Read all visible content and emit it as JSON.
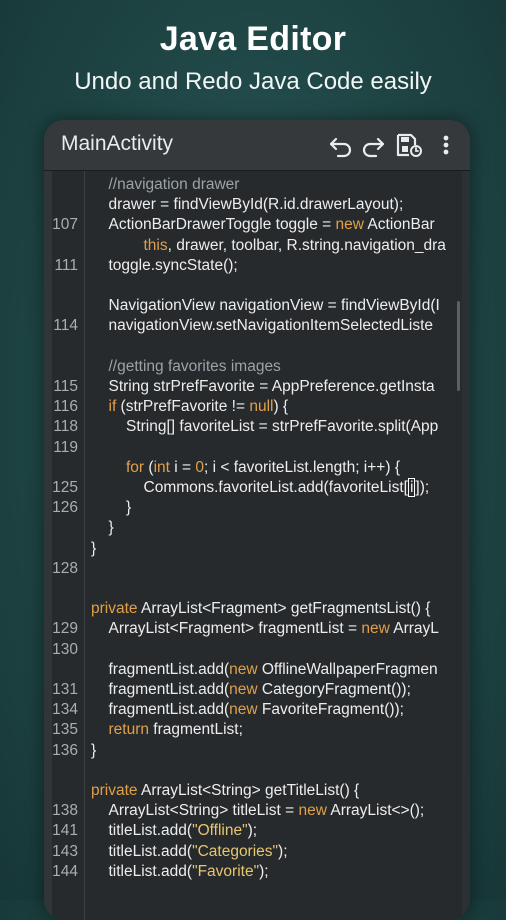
{
  "promo": {
    "title": "Java Editor",
    "subtitle": "Undo and Redo Java Code easily"
  },
  "toolbar": {
    "title": "MainActivity",
    "icons": [
      "undo-icon",
      "redo-icon",
      "save-icon",
      "more-vert-icon"
    ]
  },
  "colors": {
    "background": "#1f4545",
    "editor_bg": "#272a2d",
    "toolbar_bg": "#35393c",
    "keyword": "#e0a04a",
    "string": "#e7c66c",
    "comment": "#9aa3a8",
    "text": "#ededed",
    "line_number": "#a8aeb1"
  },
  "editor": {
    "lines": [
      {
        "no": "",
        "indent": 1,
        "segs": [
          [
            "c",
            "//navigation drawer"
          ]
        ]
      },
      {
        "no": "",
        "indent": 1,
        "segs": [
          [
            "t",
            "drawer = findViewById(R.id.drawerLayout);"
          ]
        ]
      },
      {
        "no": "107",
        "indent": 1,
        "segs": [
          [
            "t",
            "ActionBarDrawerToggle toggle = "
          ],
          [
            "k",
            "new"
          ],
          [
            "t",
            " ActionBar"
          ]
        ]
      },
      {
        "no": "",
        "indent": 3,
        "segs": [
          [
            "k",
            "this"
          ],
          [
            "t",
            ", drawer, toolbar, R.string.navigation_dra"
          ]
        ]
      },
      {
        "no": "111",
        "indent": 1,
        "segs": [
          [
            "t",
            "toggle.syncState();"
          ]
        ]
      },
      {
        "no": "",
        "indent": 0,
        "segs": []
      },
      {
        "no": "",
        "indent": 1,
        "segs": [
          [
            "t",
            "NavigationView navigationView = findViewById(I"
          ]
        ]
      },
      {
        "no": "114",
        "indent": 1,
        "segs": [
          [
            "t",
            "navigationView.setNavigationItemSelectedListe"
          ]
        ]
      },
      {
        "no": "",
        "indent": 0,
        "segs": []
      },
      {
        "no": "",
        "indent": 1,
        "segs": [
          [
            "c",
            "//getting favorites images"
          ]
        ]
      },
      {
        "no": "115",
        "indent": 1,
        "segs": [
          [
            "t",
            "String strPrefFavorite = AppPreference.getInsta"
          ]
        ]
      },
      {
        "no": "116",
        "indent": 1,
        "segs": [
          [
            "k",
            "if"
          ],
          [
            "t",
            " (strPrefFavorite != "
          ],
          [
            "k",
            "null"
          ],
          [
            "t",
            ") {"
          ]
        ]
      },
      {
        "no": "118",
        "indent": 2,
        "segs": [
          [
            "t",
            "String[] favoriteList = strPrefFavorite.split(App"
          ]
        ]
      },
      {
        "no": "119",
        "indent": 0,
        "segs": []
      },
      {
        "no": "",
        "indent": 2,
        "segs": [
          [
            "k",
            "for"
          ],
          [
            "t",
            " ("
          ],
          [
            "k",
            "int"
          ],
          [
            "t",
            " i = "
          ],
          [
            "k",
            "0"
          ],
          [
            "t",
            "; i < favoriteList.length; i++) {"
          ]
        ]
      },
      {
        "no": "125",
        "indent": 3,
        "segs": [
          [
            "t",
            "Commons.favoriteList.add(favoriteList["
          ],
          [
            "s",
            "i"
          ],
          [
            "t",
            "]);"
          ]
        ]
      },
      {
        "no": "126",
        "indent": 2,
        "segs": [
          [
            "t",
            "}"
          ]
        ]
      },
      {
        "no": "",
        "indent": 1,
        "segs": [
          [
            "t",
            "}"
          ]
        ]
      },
      {
        "no": "",
        "indent": 0,
        "segs": [
          [
            "t",
            "}"
          ]
        ]
      },
      {
        "no": "128",
        "indent": 0,
        "segs": []
      },
      {
        "no": "",
        "indent": 0,
        "segs": []
      },
      {
        "no": "",
        "indent": 0,
        "segs": [
          [
            "k",
            "private"
          ],
          [
            "t",
            " ArrayList<Fragment> getFragmentsList() {"
          ]
        ]
      },
      {
        "no": "129",
        "indent": 1,
        "segs": [
          [
            "t",
            "ArrayList<Fragment> fragmentList = "
          ],
          [
            "k",
            "new"
          ],
          [
            "t",
            " ArrayL"
          ]
        ]
      },
      {
        "no": "130",
        "indent": 0,
        "segs": []
      },
      {
        "no": "",
        "indent": 1,
        "segs": [
          [
            "t",
            "fragmentList.add("
          ],
          [
            "k",
            "new"
          ],
          [
            "t",
            " OfflineWallpaperFragmen"
          ]
        ]
      },
      {
        "no": "131",
        "indent": 1,
        "segs": [
          [
            "t",
            "fragmentList.add("
          ],
          [
            "k",
            "new"
          ],
          [
            "t",
            " CategoryFragment());"
          ]
        ]
      },
      {
        "no": "134",
        "indent": 1,
        "segs": [
          [
            "t",
            "fragmentList.add("
          ],
          [
            "k",
            "new"
          ],
          [
            "t",
            " FavoriteFragment());"
          ]
        ]
      },
      {
        "no": "135",
        "indent": 1,
        "segs": [
          [
            "k",
            "return"
          ],
          [
            "t",
            " fragmentList;"
          ]
        ]
      },
      {
        "no": "136",
        "indent": 0,
        "segs": [
          [
            "t",
            "}"
          ]
        ]
      },
      {
        "no": "",
        "indent": 0,
        "segs": []
      },
      {
        "no": "",
        "indent": 0,
        "segs": [
          [
            "k",
            "private"
          ],
          [
            "t",
            " ArrayList<String> getTitleList() {"
          ]
        ]
      },
      {
        "no": "138",
        "indent": 1,
        "segs": [
          [
            "t",
            "ArrayList<String> titleList = "
          ],
          [
            "k",
            "new"
          ],
          [
            "t",
            " ArrayList<>();"
          ]
        ]
      },
      {
        "no": "141",
        "indent": 1,
        "segs": [
          [
            "t",
            "titleList.add("
          ],
          [
            "q",
            "\"Offline\""
          ],
          [
            "t",
            ");"
          ]
        ]
      },
      {
        "no": "143",
        "indent": 1,
        "segs": [
          [
            "t",
            "titleList.add("
          ],
          [
            "q",
            "\"Categories\""
          ],
          [
            "t",
            ");"
          ]
        ]
      },
      {
        "no": "144",
        "indent": 1,
        "segs": [
          [
            "t",
            "titleList.add("
          ],
          [
            "q",
            "\"Favorite\""
          ],
          [
            "t",
            ");"
          ]
        ]
      }
    ]
  }
}
